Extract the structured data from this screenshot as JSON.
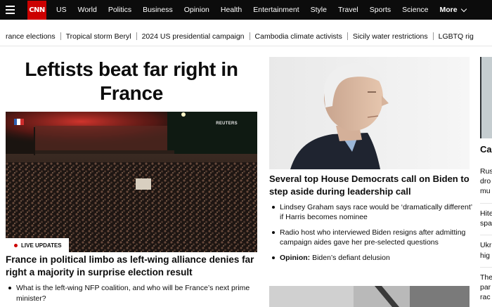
{
  "nav": {
    "logo": "CNN",
    "links": [
      "US",
      "World",
      "Politics",
      "Business",
      "Opinion",
      "Health",
      "Entertainment",
      "Style",
      "Travel",
      "Sports",
      "Science"
    ],
    "more_label": "More"
  },
  "trending": [
    "rance elections",
    "Tropical storm Beryl",
    "2024 US presidential campaign",
    "Cambodia climate activists",
    "Sicily water restrictions",
    "LGBTQ rig"
  ],
  "lead": {
    "headline": "Leftists beat far right in France",
    "image_credit": "REUTERS",
    "live_badge": "LIVE UPDATES",
    "title": "France in political limbo as left-wing alliance denies far right a majority in surprise election result",
    "bullets": [
      "What is the left-wing NFP coalition, and who will be France’s next prime minister?"
    ]
  },
  "middle": {
    "title": "Several top House Democrats call on Biden to step aside during leadership call",
    "bullets": [
      {
        "prefix": "",
        "text": "Lindsey Graham says race would be ‘dramatically different’ if Harris becomes nominee"
      },
      {
        "prefix": "",
        "text": "Radio host who interviewed Biden resigns after admitting campaign aides gave her pre-selected questions"
      },
      {
        "prefix": "Opinion:",
        "text": " Biden’s defiant delusion"
      }
    ]
  },
  "right": {
    "title": "Ca",
    "lines": [
      "Rus",
      "dro",
      "mu",
      "Hite",
      "spa",
      "Ukr",
      "hig",
      "The",
      "par",
      "rac"
    ]
  },
  "colors": {
    "nav_bg": "#0c0c0c",
    "brand_red": "#cc0000"
  }
}
